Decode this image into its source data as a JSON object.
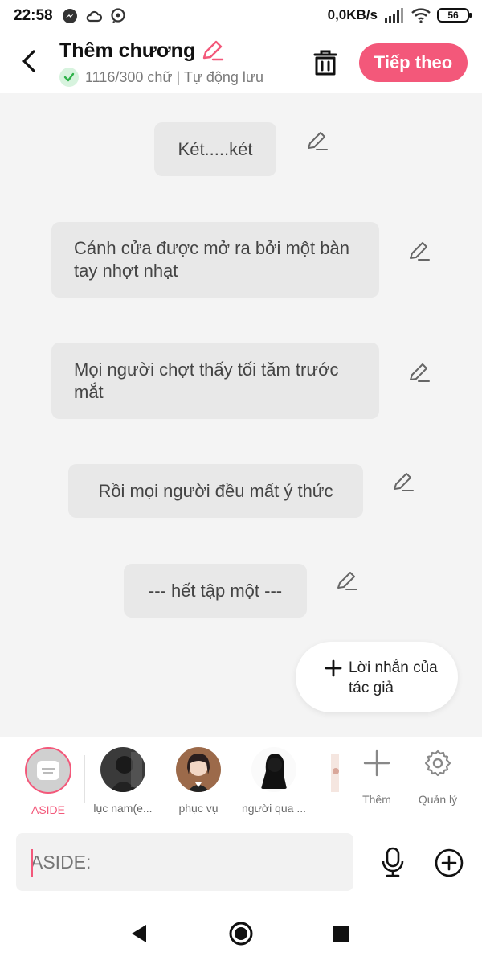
{
  "status_bar": {
    "time": "22:58",
    "speed": "0,0KB/s",
    "battery": "56"
  },
  "header": {
    "title": "Thêm chương",
    "subtitle": "1116/300 chữ | Tự động lưu",
    "next_label": "Tiếp theo",
    "accent_color": "#f3587a"
  },
  "messages": [
    {
      "text": "Két.....két"
    },
    {
      "text": "Cánh cửa được mở ra bởi một bàn tay nhợt nhạt"
    },
    {
      "text": "Mọi người chợt thấy tối tăm trước mắt"
    },
    {
      "text": "Rồi mọi người đều mất ý thức"
    },
    {
      "text": "--- hết tập một ---"
    }
  ],
  "author_note": {
    "label": "Lời nhắn của tác giả"
  },
  "characters": [
    {
      "name": "ASIDE"
    },
    {
      "name": "lục nam(e..."
    },
    {
      "name": "phục vụ"
    },
    {
      "name": "người qua ..."
    }
  ],
  "tools": {
    "add_label": "Thêm",
    "manage_label": "Quản lý"
  },
  "input": {
    "placeholder": "ASIDE:"
  }
}
